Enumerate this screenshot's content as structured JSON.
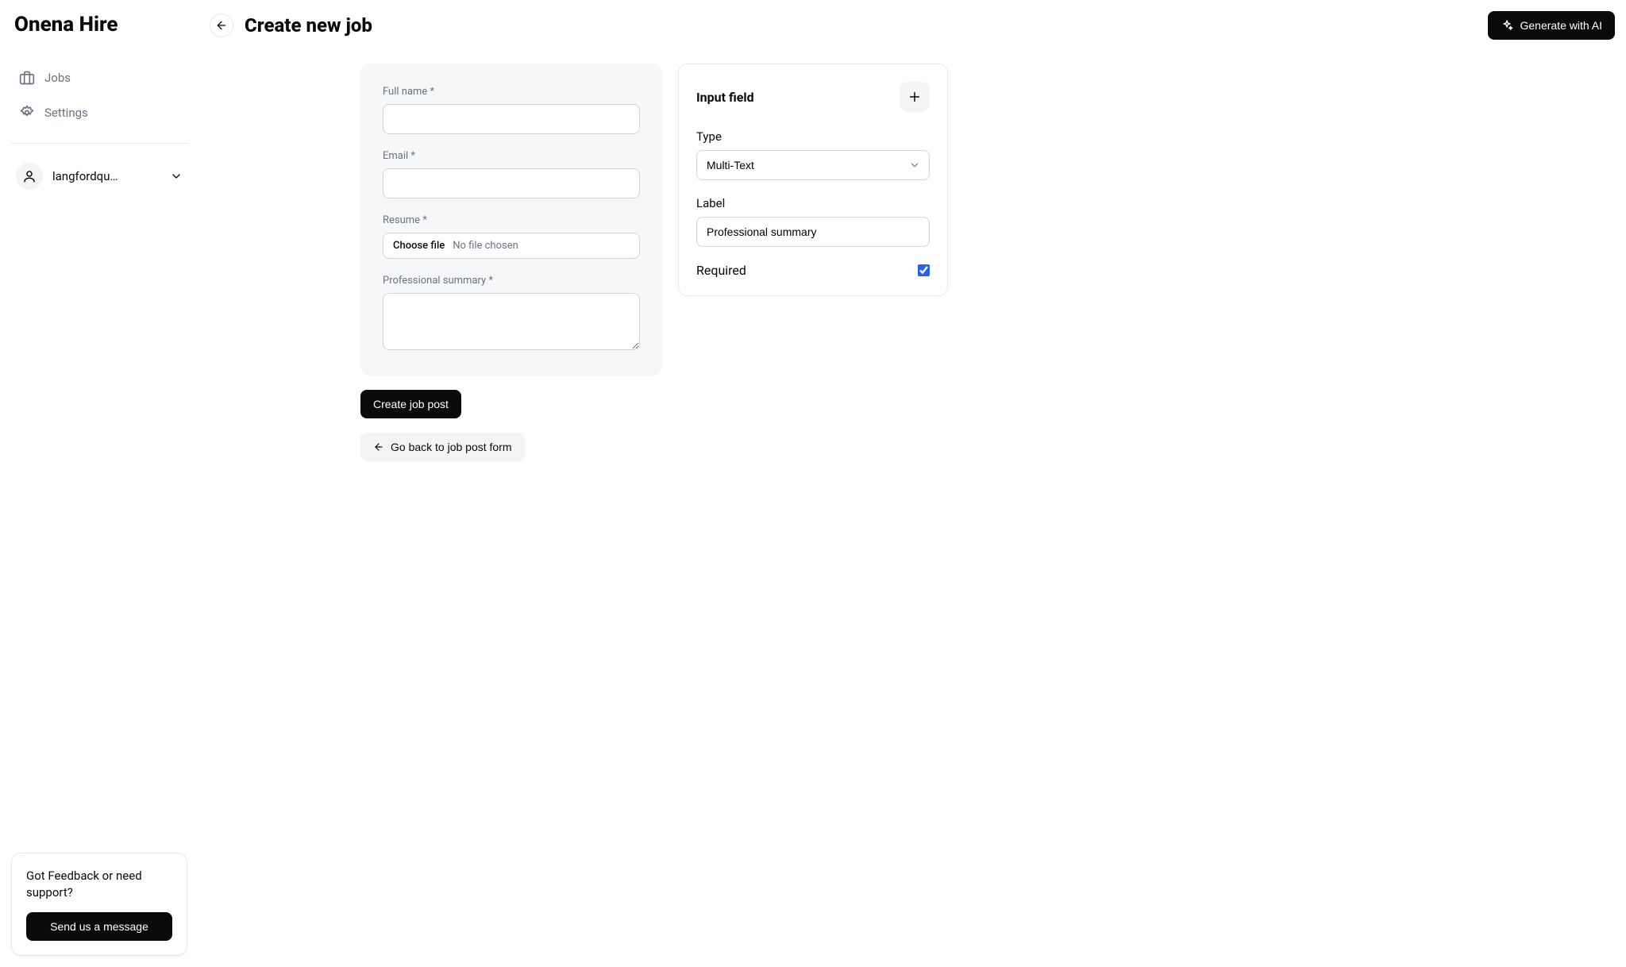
{
  "app_name": "Onena Hire",
  "sidebar": {
    "items": [
      {
        "label": "Jobs"
      },
      {
        "label": "Settings"
      }
    ],
    "user_display": "langfordqu…"
  },
  "feedback": {
    "prompt": "Got Feedback or need support?",
    "button": "Send us a message"
  },
  "topbar": {
    "title": "Create new job",
    "ai_button": "Generate with AI"
  },
  "form": {
    "full_name_label": "Full name *",
    "email_label": "Email *",
    "resume_label": "Resume *",
    "file_choose": "Choose file",
    "file_none": "No file chosen",
    "summary_label": "Professional summary *"
  },
  "actions": {
    "create": "Create job post",
    "back": "Go back to job post form"
  },
  "config": {
    "title": "Input field",
    "type_label": "Type",
    "type_value": "Multi-Text",
    "label_label": "Label",
    "label_value": "Professional summary",
    "required_label": "Required",
    "required_checked": true
  }
}
